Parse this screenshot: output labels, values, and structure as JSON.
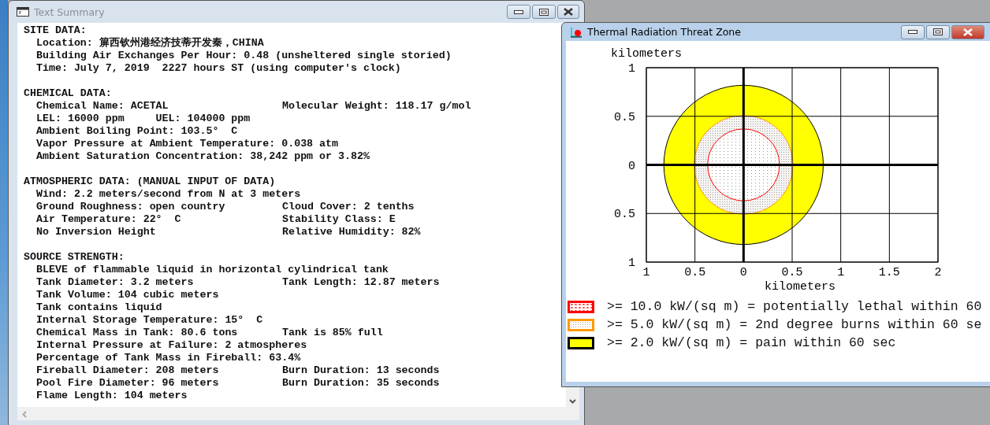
{
  "text_window": {
    "title": "Text Summary",
    "active": false,
    "sections": [
      {
        "heading": "SITE DATA:",
        "lines": [
          {
            "text": "Location: 箳西钦州港经济技蒂开发秦，CHINA"
          },
          {
            "text": "Building Air Exchanges Per Hour: 0.48 (unsheltered single storied)"
          },
          {
            "text": "Time: July 7, 2019  2227 hours ST (using computer's clock)"
          }
        ]
      },
      {
        "heading": "CHEMICAL DATA:",
        "lines": [
          {
            "text": "Chemical Name: ACETAL",
            "right": "Molecular Weight: 118.17 g/mol"
          },
          {
            "text": "LEL: 16000 ppm     UEL: 104000 ppm"
          },
          {
            "text": "Ambient Boiling Point: 103.5°  C"
          },
          {
            "text": "Vapor Pressure at Ambient Temperature: 0.038 atm"
          },
          {
            "text": "Ambient Saturation Concentration: 38,242 ppm or 3.82%"
          }
        ]
      },
      {
        "heading": "ATMOSPHERIC DATA: (MANUAL INPUT OF DATA)",
        "lines": [
          {
            "text": "Wind: 2.2 meters/second from N at 3 meters"
          },
          {
            "text": "Ground Roughness: open country",
            "right": "Cloud Cover: 2 tenths"
          },
          {
            "text": "Air Temperature: 22°  C",
            "right": "Stability Class: E"
          },
          {
            "text": "No Inversion Height",
            "right": "Relative Humidity: 82%"
          }
        ]
      },
      {
        "heading": "SOURCE STRENGTH:",
        "lines": [
          {
            "text": "BLEVE of flammable liquid in horizontal cylindrical tank"
          },
          {
            "text": "Tank Diameter: 3.2 meters",
            "right": "Tank Length: 12.87 meters"
          },
          {
            "text": "Tank Volume: 104 cubic meters"
          },
          {
            "text": "Tank contains liquid"
          },
          {
            "text": "Internal Storage Temperature: 15°  C"
          },
          {
            "text": "Chemical Mass in Tank: 80.6 tons",
            "right": "Tank is 85% full"
          },
          {
            "text": "Internal Pressure at Failure: 2 atmospheres"
          },
          {
            "text": "Percentage of Tank Mass in Fireball: 63.4%"
          },
          {
            "text": "Fireball Diameter: 208 meters",
            "right": "Burn Duration: 13 seconds"
          },
          {
            "text": "Pool Fire Diameter: 96 meters",
            "right": "Burn Duration: 35 seconds"
          },
          {
            "text": "Flame Length: 104 meters"
          }
        ]
      }
    ]
  },
  "chart_window": {
    "title": "Thermal Radiation Threat Zone",
    "active": true,
    "plot": {
      "ylabel": "kilometers",
      "xlabel": "kilometers",
      "yticks": [
        "1",
        "0.5",
        "0",
        "0.5",
        "1"
      ],
      "xticks": [
        "1",
        "0.5",
        "0",
        "0.5",
        "1",
        "1.5",
        "2"
      ]
    },
    "legend": [
      {
        "kind": "sparse",
        "color": "#ff0000",
        "text": ">= 10.0 kW/(sq m) = potentially lethal within 60"
      },
      {
        "kind": "dense",
        "color": "#ff9900",
        "text": ">= 5.0 kW/(sq m) = 2nd degree burns within 60 se"
      },
      {
        "kind": "solid",
        "color": "#000000",
        "text": ">= 2.0 kW/(sq m) = pain within 60 sec"
      }
    ]
  }
}
